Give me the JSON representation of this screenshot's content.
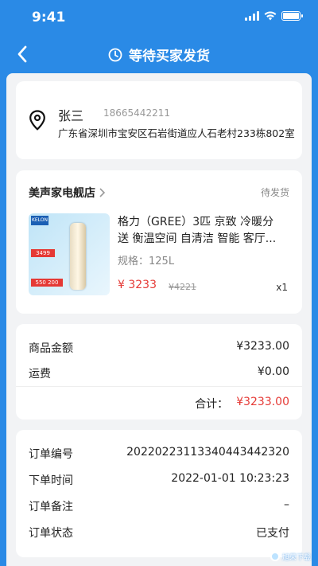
{
  "status_bar": {
    "time": "9:41"
  },
  "header": {
    "title": "等待买家发货"
  },
  "address": {
    "name": "张三",
    "phone": "18665442211",
    "detail": "广东省深圳市宝安区石岩街道应人石老村233栋802室"
  },
  "shop": {
    "name": "美声家电舰店",
    "status": "待发货",
    "product": {
      "title": "格力（GREE）3匹 京致 冷暖分送 衡温空间 自清洁 智能 客厅...",
      "spec": "规格：125L",
      "price": "¥ 3233",
      "original_price": "¥4221",
      "qty": "x1",
      "thumb": {
        "brand": "KELON",
        "tag1": "3499",
        "tag2": "550 200"
      }
    }
  },
  "amount": {
    "goods_label": "商品金额",
    "goods_value": "¥3233.00",
    "shipping_label": "运费",
    "shipping_value": "¥0.00",
    "total_label": "合计：",
    "total_value": "¥3233.00"
  },
  "order": {
    "rows": [
      {
        "label": "订单编号",
        "value": "20220223113340443442320"
      },
      {
        "label": "下单时间",
        "value": "2022-01-01 10:23:23"
      },
      {
        "label": "订单备注",
        "value": "–"
      },
      {
        "label": "订单状态",
        "value": "已支付"
      }
    ]
  },
  "watermark": {
    "text": "旭荣下载"
  }
}
